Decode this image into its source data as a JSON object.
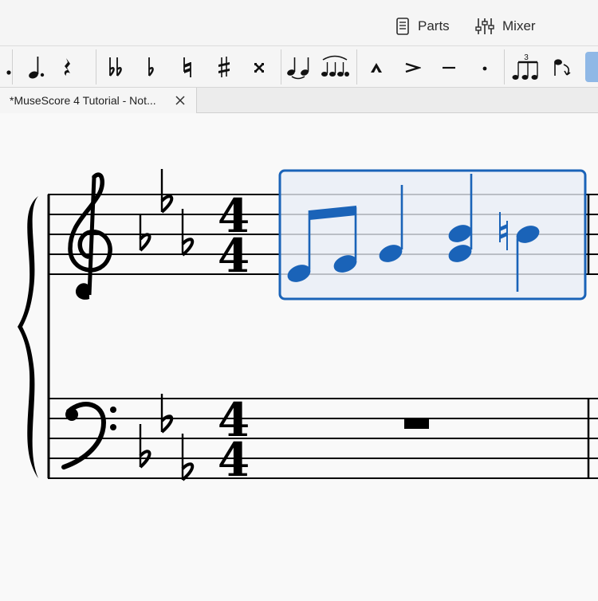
{
  "header": {
    "parts_label": "Parts",
    "mixer_label": "Mixer"
  },
  "toolbar": {
    "buttons": [
      {
        "id": "augmentation-dot",
        "icon": "augmentation-dot-icon"
      },
      {
        "id": "dotted-quarter-note",
        "icon": "dotted-quarter-note-icon"
      },
      {
        "id": "rest",
        "icon": "quarter-rest-icon"
      },
      {
        "id": "double-flat",
        "icon": "double-flat-icon"
      },
      {
        "id": "flat",
        "icon": "flat-icon"
      },
      {
        "id": "natural",
        "icon": "natural-icon"
      },
      {
        "id": "sharp",
        "icon": "sharp-icon"
      },
      {
        "id": "double-sharp",
        "icon": "double-sharp-icon"
      },
      {
        "id": "tie",
        "icon": "tie-icon"
      },
      {
        "id": "slur",
        "icon": "slur-icon"
      },
      {
        "id": "marcato",
        "icon": "marcato-icon"
      },
      {
        "id": "accent",
        "icon": "accent-icon"
      },
      {
        "id": "tenuto",
        "icon": "tenuto-icon"
      },
      {
        "id": "staccato",
        "icon": "staccato-icon"
      },
      {
        "id": "tuplet",
        "icon": "triplet-icon",
        "label": "3"
      },
      {
        "id": "flip-direction",
        "icon": "flip-direction-icon"
      }
    ]
  },
  "tabs": [
    {
      "title": "*MuseScore 4 Tutorial - Not..."
    }
  ],
  "score": {
    "key_signature": "E-flat major (3 flats)",
    "time_signature": {
      "top": "4",
      "bottom": "4"
    },
    "selection_color": "#1a63b8",
    "treble_notes": [
      "E4 eighth",
      "F4 eighth",
      "G4 quarter",
      "G4+B4 quarter chord",
      "B-natural 4 quarter"
    ],
    "bass_content": "whole rest"
  }
}
